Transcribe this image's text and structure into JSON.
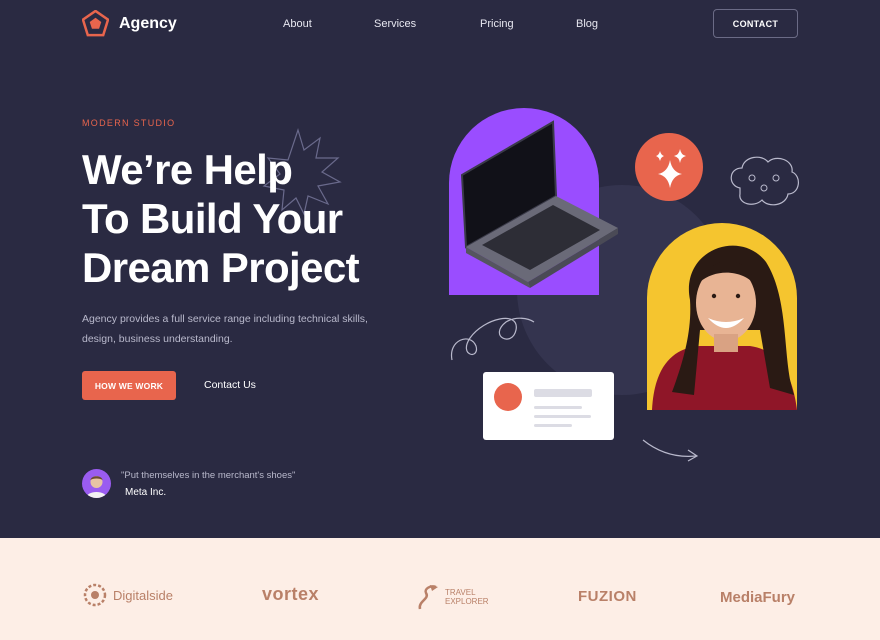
{
  "brand": {
    "name": "Agency"
  },
  "nav": {
    "links": [
      "About",
      "Services",
      "Pricing",
      "Blog"
    ],
    "contact_label": "CONTACT"
  },
  "hero": {
    "eyebrow": "MODERN STUDIO",
    "headline_lines": [
      "We’re Help",
      "To Build Your",
      "Dream Project"
    ],
    "description": "Agency provides a full service range including technical skills, design, business understanding.",
    "cta_label": "HOW WE WORK",
    "secondary_label": "Contact Us"
  },
  "testimonial": {
    "quote": "\"Put themselves in the merchant's shoes\"",
    "company": "Meta Inc."
  },
  "partners": [
    "Digitalside",
    "vortex",
    "TRAVEL EXPLORER",
    "FUZION",
    "MediaFury"
  ],
  "colors": {
    "background": "#2a2a42",
    "accent": "#e8654d",
    "purple": "#9a4dff",
    "yellow": "#f5c52f",
    "logo_strip": "#fdeee6"
  }
}
